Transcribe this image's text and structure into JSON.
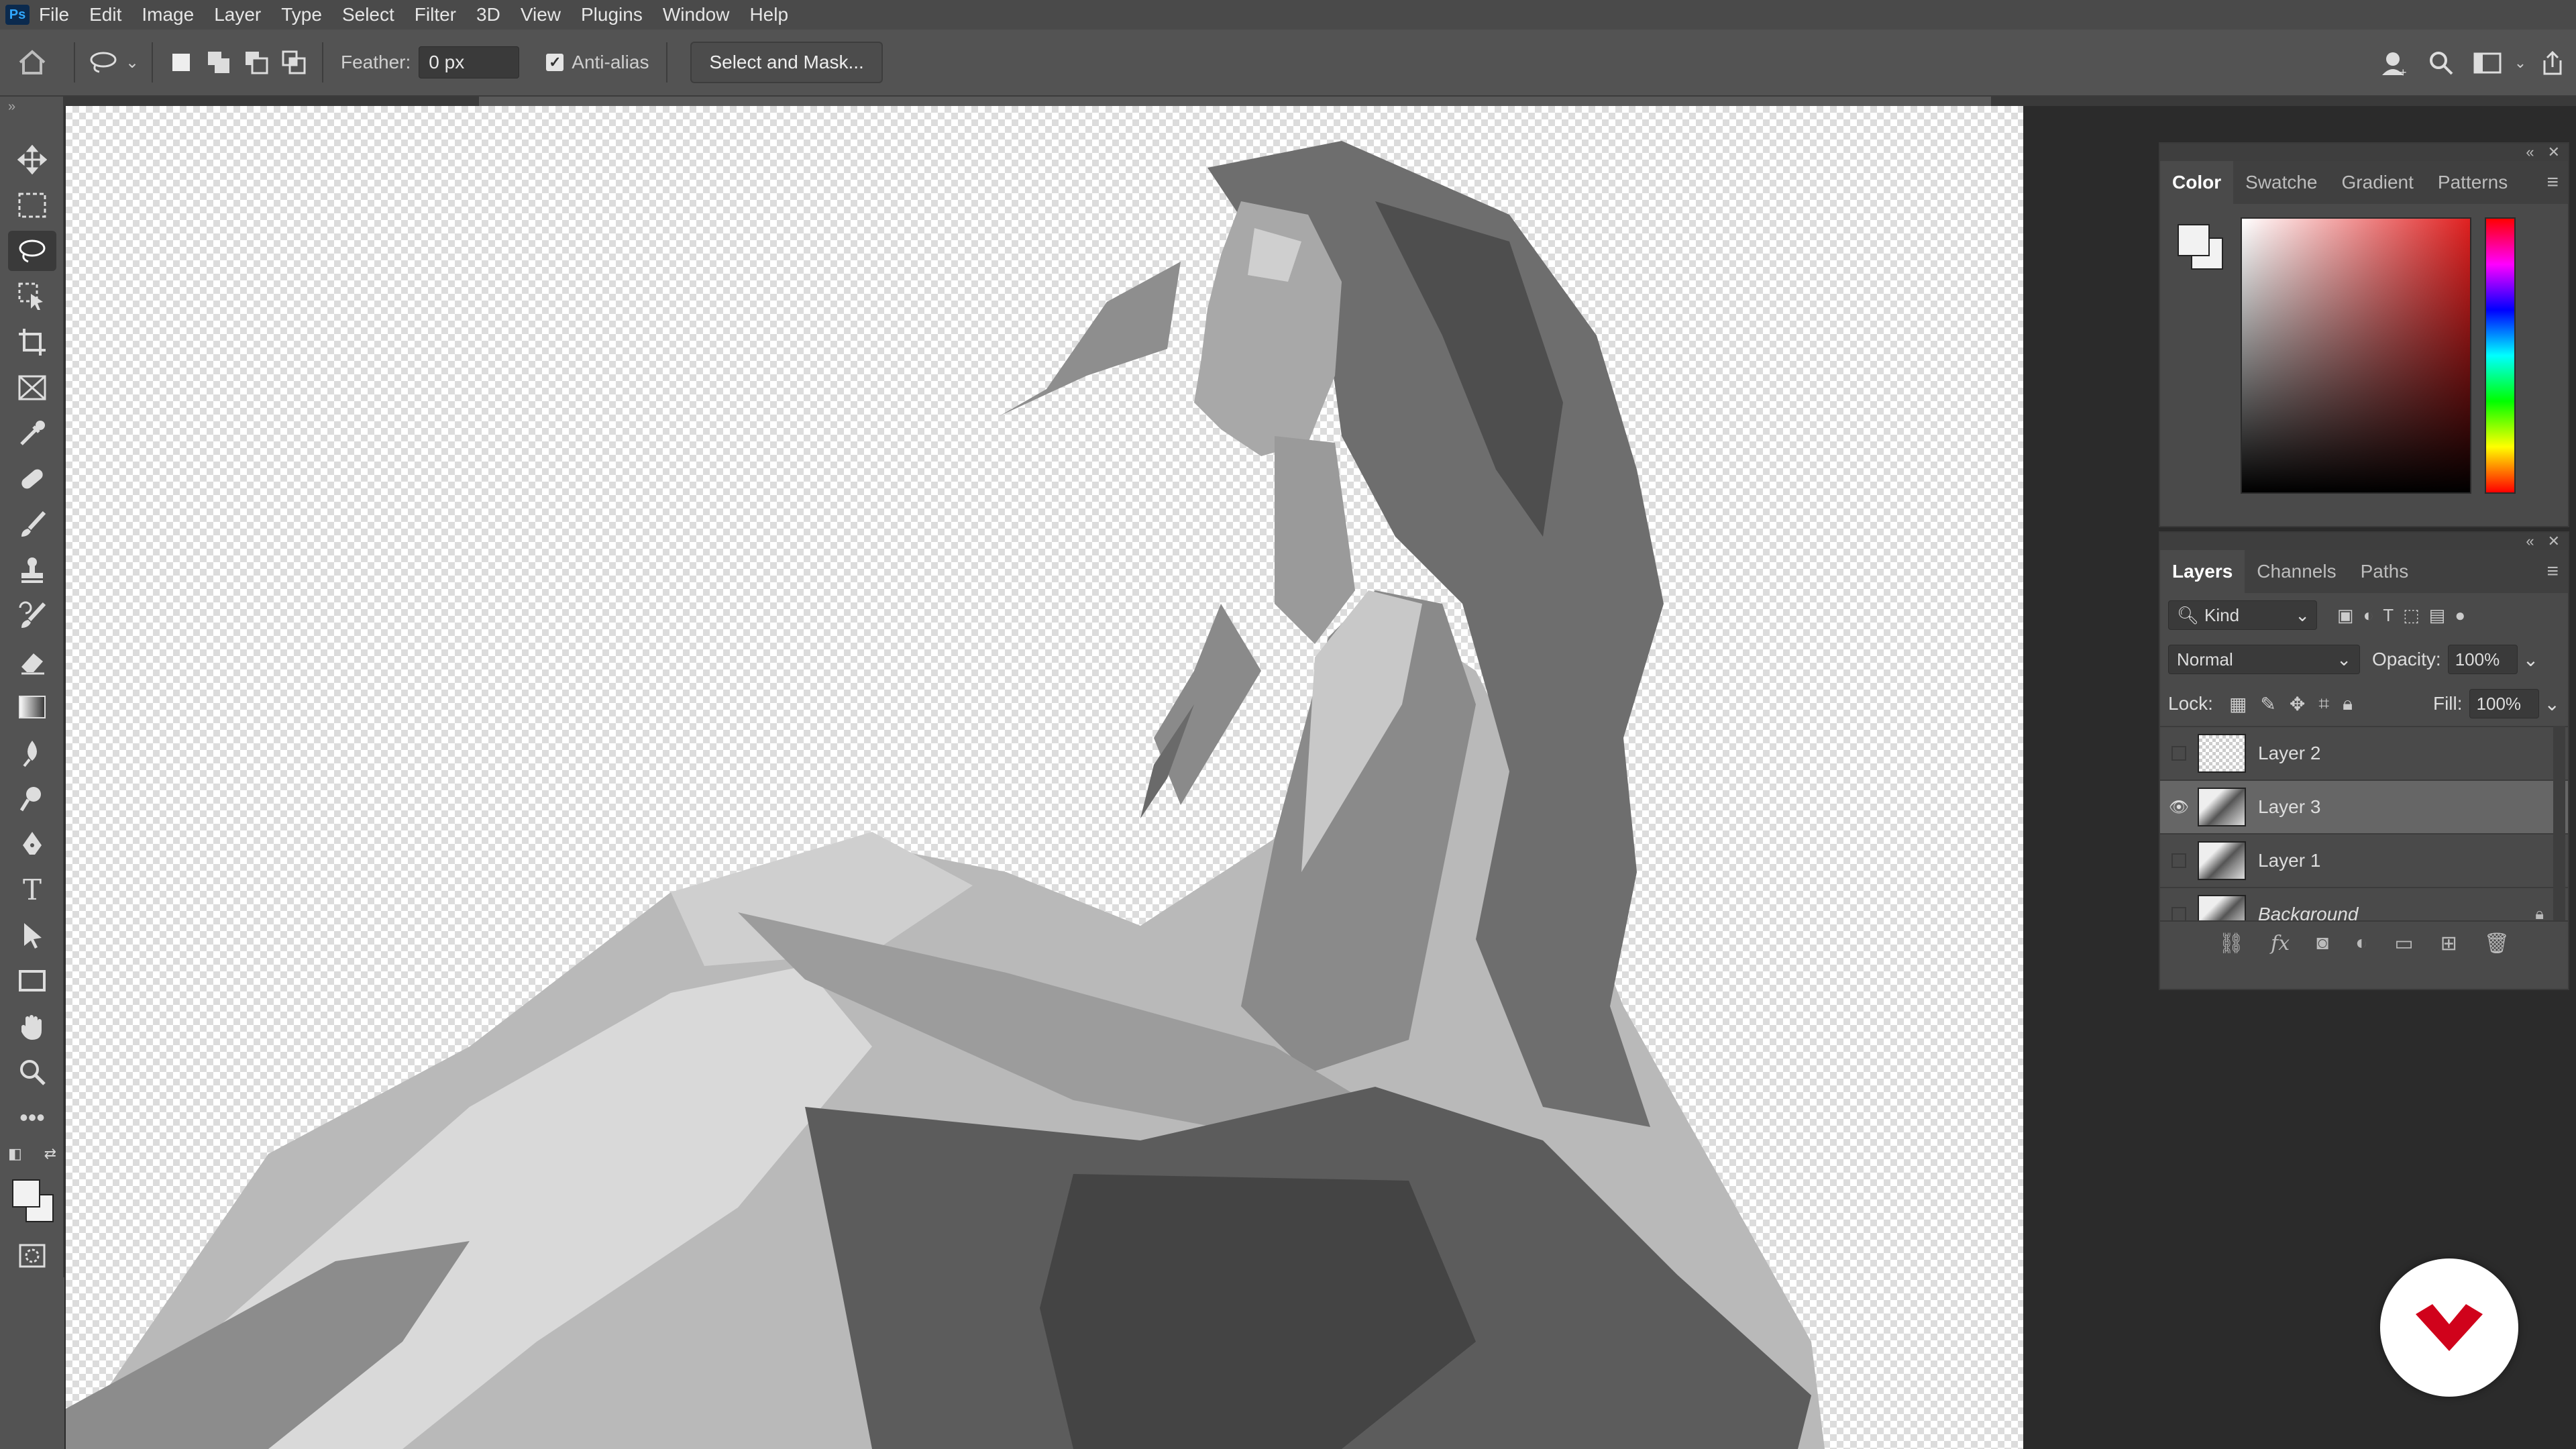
{
  "menu": [
    "File",
    "Edit",
    "Image",
    "Layer",
    "Type",
    "Select",
    "Filter",
    "3D",
    "View",
    "Plugins",
    "Window",
    "Help"
  ],
  "app_badge": "Ps",
  "options": {
    "feather_label": "Feather:",
    "feather_value": "0 px",
    "antialias_label": "Anti-alias",
    "antialias_checked": true,
    "select_and_mask": "Select and Mask..."
  },
  "color_panel": {
    "tabs": [
      "Color",
      "Swatche",
      "Gradient",
      "Patterns"
    ],
    "active_tab": "Color",
    "foreground": "#f2f2f2",
    "background": "#f2f2f2"
  },
  "layers_panel": {
    "tabs": [
      "Layers",
      "Channels",
      "Paths"
    ],
    "active_tab": "Layers",
    "filter_kind": "Kind",
    "blend_mode": "Normal",
    "opacity_label": "Opacity:",
    "opacity": "100%",
    "lock_label": "Lock:",
    "fill_label": "Fill:",
    "fill": "100%",
    "layers": [
      {
        "name": "Layer 2",
        "visible": false,
        "selected": false
      },
      {
        "name": "Layer 3",
        "visible": true,
        "selected": true
      },
      {
        "name": "Layer 1",
        "visible": false,
        "selected": false
      },
      {
        "name": "Background",
        "visible": false,
        "selected": false,
        "locked": true
      }
    ]
  },
  "colors": {
    "accent": "#31a8ff",
    "logo": "#d0021b"
  }
}
